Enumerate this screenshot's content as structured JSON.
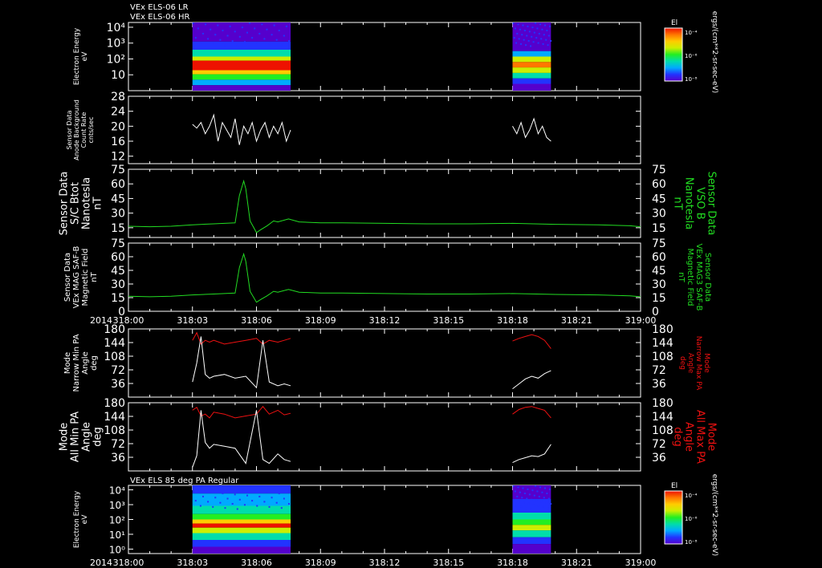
{
  "header": {
    "title_lines": [
      "VEx ELS-06 LR",
      "VEx ELS-06 HR"
    ],
    "bottom_panel_title": "VEx ELS 85 deg PA Regular"
  },
  "colors": {
    "background": "#000000",
    "axis": "#ffffff",
    "b_field": "#22dd22",
    "max_pa": "#ee1111",
    "min_pa": "#ffffff"
  },
  "colorbars": [
    {
      "label": "El",
      "ticks": [
        "10⁻⁴",
        "10⁻⁶",
        "10⁻⁸"
      ],
      "unit": "ergs/(cm**2-sr-sec-eV)"
    },
    {
      "label": "El",
      "ticks": [
        "10⁻⁴",
        "10⁻⁶",
        "10⁻⁸"
      ],
      "unit": "ergs/(cm**2-sr-sec-eV)"
    }
  ],
  "time_axis": {
    "year": "2014",
    "ticks": [
      "318:00",
      "318:03",
      "318:06",
      "318:09",
      "318:12",
      "318:15",
      "318:18",
      "318:21",
      "319:00"
    ]
  },
  "chart_data": [
    {
      "type": "heatmap",
      "panel": "els-lr-hr-spectrogram",
      "ylabel_lines": [
        "Electron Energy",
        "eV"
      ],
      "yscale": "log",
      "ylim": [
        1,
        20000
      ],
      "ytick_labels": [
        "10⁴",
        "10³",
        "10²",
        "10"
      ],
      "x_unit": "minutes since 318:00",
      "data_intervals": [
        [
          3.0,
          7.6
        ],
        [
          18.0,
          19.8
        ]
      ],
      "colorbar_range": [
        1e-08,
        0.0001
      ]
    },
    {
      "type": "line",
      "panel": "sensor-background",
      "ylabel_lines": [
        "Sensor Data",
        "Anode Background",
        "Count Rate",
        "cnts/sec"
      ],
      "ylim": [
        10,
        28
      ],
      "yticks": [
        12,
        16,
        20,
        24,
        28
      ],
      "series": [
        {
          "color": "#ffffff",
          "x": [
            3.0,
            3.2,
            3.4,
            3.6,
            3.8,
            4.0,
            4.2,
            4.4,
            4.6,
            4.8,
            5.0,
            5.2,
            5.4,
            5.6,
            5.8,
            6.0,
            6.2,
            6.4,
            6.6,
            6.8,
            7.0,
            7.2,
            7.4,
            7.6
          ],
          "y": [
            20.5,
            19.5,
            21,
            18,
            20,
            23,
            16,
            21,
            19,
            17,
            22,
            15,
            20,
            18,
            21,
            16,
            19,
            21,
            17,
            20,
            18,
            21,
            16,
            19
          ]
        },
        {
          "color": "#ffffff",
          "x": [
            18.0,
            18.2,
            18.4,
            18.6,
            18.8,
            19.0,
            19.2,
            19.4,
            19.6,
            19.8
          ],
          "y": [
            20,
            18,
            21,
            17,
            19,
            22,
            18,
            20,
            17,
            16
          ]
        }
      ]
    },
    {
      "type": "line",
      "panel": "sc-btot",
      "ylabel_lines": [
        "Sensor Data",
        "S/C Btot",
        "Nanotesla",
        "nT"
      ],
      "right_label_lines": [
        "Sensor Data",
        "VSO B",
        "Nanotesla",
        "nT"
      ],
      "ylim": [
        5,
        75
      ],
      "yticks": [
        15,
        30,
        45,
        60,
        75
      ],
      "series": [
        {
          "color": "#22dd22",
          "x": [
            0,
            1,
            2,
            3,
            4,
            4.5,
            5.0,
            5.2,
            5.4,
            5.5,
            5.7,
            6.0,
            6.2,
            6.5,
            6.8,
            7.0,
            7.5,
            8,
            9,
            10,
            12,
            14,
            16,
            18,
            20,
            22,
            23.5,
            24
          ],
          "y": [
            16.5,
            16,
            16.5,
            18,
            19,
            19.5,
            20,
            48,
            63,
            55,
            22,
            10,
            13,
            17,
            22,
            21,
            24,
            21,
            20,
            20,
            19.5,
            19,
            19,
            19.5,
            18.5,
            18,
            17,
            16
          ]
        }
      ]
    },
    {
      "type": "line",
      "panel": "mag-saf-b",
      "ylabel_lines": [
        "Sensor Data",
        "VEx MAG SAF-B",
        "Magnetic Field",
        "nT"
      ],
      "right_label_lines": [
        "Sensor Data",
        "VEx MAG3 SAF-B",
        "Magnetic Field",
        "nT"
      ],
      "ylim": [
        0,
        75
      ],
      "yticks": [
        0,
        15,
        30,
        45,
        60,
        75
      ],
      "series": [
        {
          "color": "#22dd22",
          "x": [
            0,
            1,
            2,
            3,
            4,
            4.5,
            5.0,
            5.2,
            5.4,
            5.5,
            5.7,
            6.0,
            6.2,
            6.5,
            6.8,
            7.0,
            7.5,
            8,
            9,
            10,
            12,
            14,
            16,
            18,
            20,
            22,
            23.5,
            24
          ],
          "y": [
            16.5,
            16,
            16.5,
            18,
            19,
            19.5,
            20,
            48,
            63,
            55,
            22,
            10,
            13,
            17,
            22,
            21,
            24,
            21,
            20,
            20,
            19.5,
            19,
            19,
            19.5,
            18.5,
            18,
            17,
            16
          ]
        }
      ]
    },
    {
      "type": "line",
      "panel": "narrow-pa",
      "ylabel_lines": [
        "Mode",
        "Narrow Min PA",
        "Angle",
        "deg"
      ],
      "right_label_lines": [
        "Mode",
        "Narrow Max PA",
        "Angle",
        "deg"
      ],
      "ylim": [
        0,
        180
      ],
      "yticks": [
        36,
        72,
        108,
        144,
        180
      ],
      "series": [
        {
          "color": "#ee1111",
          "x": [
            3.0,
            3.2,
            3.4,
            3.6,
            3.8,
            4.0,
            4.5,
            5.0,
            5.5,
            6.0,
            6.3,
            6.6,
            7.0,
            7.3,
            7.6
          ],
          "y": [
            150,
            170,
            140,
            150,
            145,
            150,
            140,
            145,
            150,
            155,
            140,
            150,
            145,
            150,
            155
          ]
        },
        {
          "color": "#ffffff",
          "x": [
            3.0,
            3.2,
            3.4,
            3.6,
            3.8,
            4.0,
            4.5,
            5.0,
            5.5,
            6.0,
            6.3,
            6.6,
            7.0,
            7.3,
            7.6
          ],
          "y": [
            40,
            90,
            160,
            60,
            50,
            55,
            60,
            50,
            55,
            25,
            150,
            40,
            30,
            35,
            30
          ]
        },
        {
          "color": "#ee1111",
          "x": [
            18.0,
            18.3,
            18.6,
            18.9,
            19.2,
            19.5,
            19.8
          ],
          "y": [
            148,
            155,
            160,
            165,
            160,
            150,
            128
          ]
        },
        {
          "color": "#ffffff",
          "x": [
            18.0,
            18.3,
            18.6,
            18.9,
            19.2,
            19.5,
            19.8
          ],
          "y": [
            22,
            35,
            48,
            55,
            50,
            62,
            70
          ]
        }
      ]
    },
    {
      "type": "line",
      "panel": "all-pa",
      "ylabel_lines": [
        "Mode",
        "All Min PA",
        "Angle",
        "deg"
      ],
      "right_label_lines": [
        "Mode",
        "All Max PA",
        "Angle",
        "deg"
      ],
      "ylim": [
        0,
        180
      ],
      "yticks": [
        36,
        72,
        108,
        144,
        180
      ],
      "series": [
        {
          "color": "#ee1111",
          "x": [
            3.0,
            3.2,
            3.4,
            3.6,
            3.8,
            4.0,
            4.5,
            5.0,
            5.5,
            6.0,
            6.3,
            6.6,
            7.0,
            7.3,
            7.6
          ],
          "y": [
            160,
            168,
            145,
            150,
            140,
            155,
            150,
            140,
            145,
            150,
            170,
            150,
            160,
            148,
            152
          ]
        },
        {
          "color": "#ffffff",
          "x": [
            3.0,
            3.2,
            3.4,
            3.6,
            3.8,
            4.0,
            4.5,
            5.0,
            5.5,
            6.0,
            6.3,
            6.6,
            7.0,
            7.3,
            7.6
          ],
          "y": [
            10,
            40,
            160,
            75,
            60,
            70,
            65,
            60,
            20,
            160,
            30,
            20,
            45,
            30,
            25
          ]
        },
        {
          "color": "#ee1111",
          "x": [
            18.0,
            18.3,
            18.6,
            18.9,
            19.2,
            19.5,
            19.8
          ],
          "y": [
            150,
            162,
            168,
            170,
            165,
            160,
            140
          ]
        },
        {
          "color": "#ffffff",
          "x": [
            18.0,
            18.3,
            18.6,
            18.9,
            19.2,
            19.5,
            19.8
          ],
          "y": [
            22,
            30,
            35,
            40,
            38,
            45,
            70
          ]
        }
      ]
    },
    {
      "type": "heatmap",
      "panel": "els-85deg-spectrogram",
      "ylabel_lines": [
        "Electron Energy",
        "eV"
      ],
      "yscale": "log",
      "ylim": [
        0.5,
        20000
      ],
      "ytick_labels": [
        "10⁴",
        "10³",
        "10²",
        "10¹",
        "10⁰"
      ],
      "x_unit": "minutes since 318:00",
      "data_intervals": [
        [
          3.0,
          7.6
        ],
        [
          18.0,
          19.8
        ]
      ],
      "colorbar_range": [
        1e-08,
        0.0001
      ]
    }
  ]
}
